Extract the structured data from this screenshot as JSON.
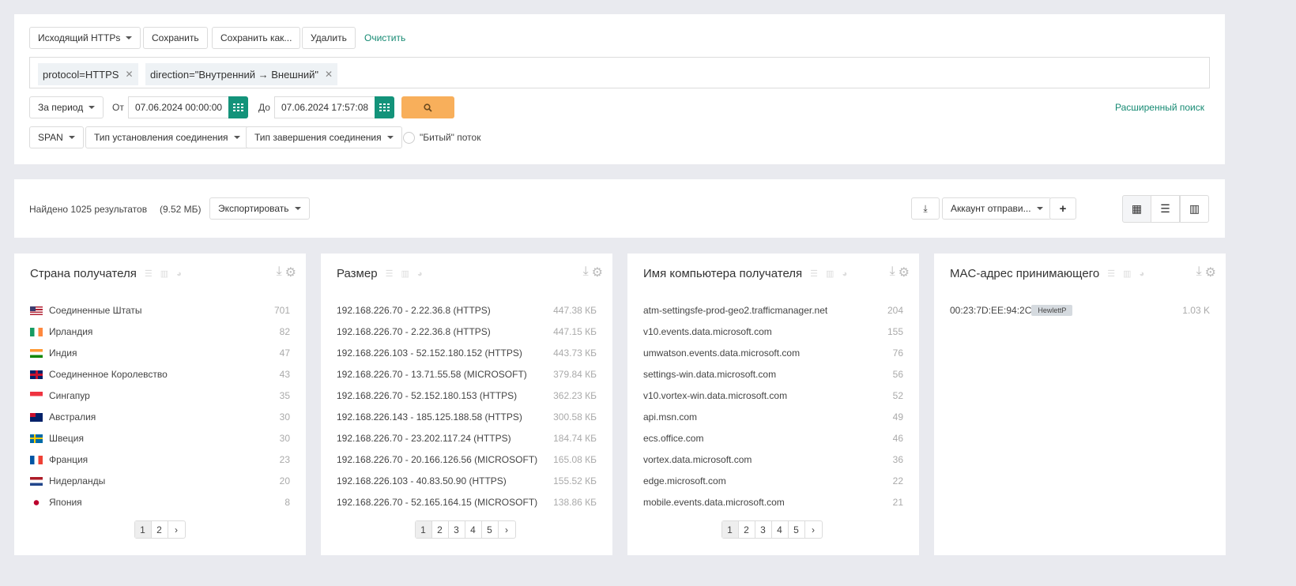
{
  "toolbar": {
    "preset": "Исходящий HTTPs",
    "save": "Сохранить",
    "save_as": "Сохранить как...",
    "delete": "Удалить",
    "clear": "Очистить"
  },
  "filters": [
    {
      "label": "protocol=HTTPS"
    },
    {
      "label": "direction=\"Внутренний → Внешний\""
    }
  ],
  "period": {
    "label": "За период",
    "from_label": "От",
    "from": "07.06.2024  00:00:00",
    "to_label": "До",
    "to": "07.06.2024  17:57:08",
    "advanced": "Расширенный поиск"
  },
  "options": {
    "span": "SPAN",
    "conn_setup": "Тип установления соединения",
    "conn_end": "Тип завершения соединения",
    "broken": "\"Битый\" поток"
  },
  "results": {
    "found": "Найдено 1025 результатов",
    "size": "(9.52 МБ)",
    "export": "Экспортировать",
    "account": "Аккаунт отправи..."
  },
  "widgets": [
    {
      "title": "Страна получателя",
      "rows": [
        [
          "Соединенные Штаты",
          "701",
          "us"
        ],
        [
          "Ирландия",
          "82",
          "ie"
        ],
        [
          "Индия",
          "47",
          "in"
        ],
        [
          "Соединенное Королевство",
          "43",
          "gb"
        ],
        [
          "Сингапур",
          "35",
          "sg"
        ],
        [
          "Австралия",
          "30",
          "au"
        ],
        [
          "Швеция",
          "30",
          "se"
        ],
        [
          "Франция",
          "23",
          "fr"
        ],
        [
          "Нидерланды",
          "20",
          "nl"
        ],
        [
          "Япония",
          "8",
          "jp"
        ]
      ],
      "pages": [
        "1",
        "2"
      ]
    },
    {
      "title": "Размер",
      "rows": [
        [
          "192.168.226.70 - 2.22.36.8 (HTTPS)",
          "447.38 КБ"
        ],
        [
          "192.168.226.70 - 2.22.36.8 (HTTPS)",
          "447.15 КБ"
        ],
        [
          "192.168.226.103 - 52.152.180.152 (HTTPS)",
          "443.73 КБ"
        ],
        [
          "192.168.226.70 - 13.71.55.58 (MICROSOFT)",
          "379.84 КБ"
        ],
        [
          "192.168.226.70 - 52.152.180.153 (HTTPS)",
          "362.23 КБ"
        ],
        [
          "192.168.226.143 - 185.125.188.58 (HTTPS)",
          "300.58 КБ"
        ],
        [
          "192.168.226.70 - 23.202.117.24 (HTTPS)",
          "184.74 КБ"
        ],
        [
          "192.168.226.70 - 20.166.126.56 (MICROSOFT)",
          "165.08 КБ"
        ],
        [
          "192.168.226.103 - 40.83.50.90 (HTTPS)",
          "155.52 КБ"
        ],
        [
          "192.168.226.70 - 52.165.164.15 (MICROSOFT)",
          "138.86 КБ"
        ]
      ],
      "pages": [
        "1",
        "2",
        "3",
        "4",
        "5"
      ]
    },
    {
      "title": "Имя компьютера получателя",
      "rows": [
        [
          "atm-settingsfe-prod-geo2.trafficmanager.net",
          "204"
        ],
        [
          "v10.events.data.microsoft.com",
          "155"
        ],
        [
          "umwatson.events.data.microsoft.com",
          "76"
        ],
        [
          "settings-win.data.microsoft.com",
          "56"
        ],
        [
          "v10.vortex-win.data.microsoft.com",
          "52"
        ],
        [
          "api.msn.com",
          "49"
        ],
        [
          "ecs.office.com",
          "46"
        ],
        [
          "vortex.data.microsoft.com",
          "36"
        ],
        [
          "edge.microsoft.com",
          "22"
        ],
        [
          "mobile.events.data.microsoft.com",
          "21"
        ]
      ],
      "pages": [
        "1",
        "2",
        "3",
        "4",
        "5"
      ]
    },
    {
      "title": "MAC-адрес принимающего",
      "rows": [
        [
          "00:23:7D:EE:94:2C",
          "1.03 K",
          "HewlettP"
        ]
      ],
      "pages": []
    }
  ],
  "colors": {
    "accent": "#13937a",
    "search": "#f8af5b",
    "bg": "#e9eaef"
  }
}
